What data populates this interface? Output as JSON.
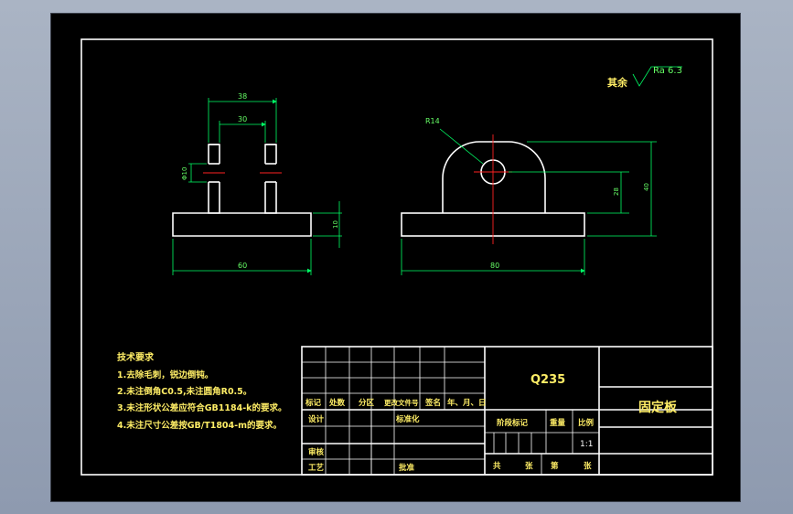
{
  "roughness": {
    "label": "其余",
    "value": "Ra 6.3"
  },
  "dims": {
    "top_outer": "38",
    "top_inner": "30",
    "left_hole": "Φ10",
    "base_height": "10",
    "base_width_left": "60",
    "base_width_right": "80",
    "hole_label": "R14",
    "h_center": "28",
    "h_total": "40"
  },
  "tech_notes": {
    "title": "技术要求",
    "items": [
      "1.去除毛刺，锐边倒钝。",
      "2.未注倒角C0.5,未注圆角R0.5。",
      "3.未注形状公差应符合GB1184-k的要求。",
      "4.未注尺寸公差按GB/T1804-m的要求。"
    ]
  },
  "title_block": {
    "material": "Q235",
    "part_name": "固定板",
    "row_headers": [
      "标记",
      "处数",
      "分区",
      "更改文件号",
      "签名",
      "年、月、日"
    ],
    "design": "设计",
    "standardize": "标准化",
    "review": "审核",
    "process": "工艺",
    "approve": "批准",
    "stage_mark": "阶段标记",
    "weight": "重量",
    "scale": "比例",
    "scale_value": "1:1",
    "sheet_total": "共",
    "sheet_unit": "张",
    "sheet_num": "第",
    "sheet_unit2": "张"
  }
}
